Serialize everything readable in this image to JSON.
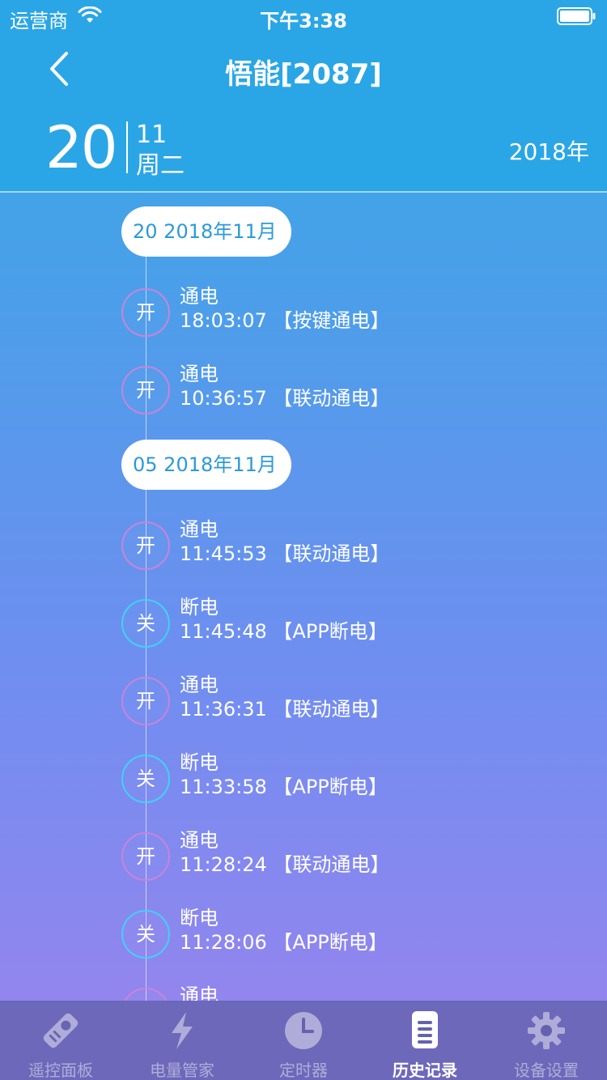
{
  "status_bar": {
    "carrier": "运营商",
    "time": "下午3:38"
  },
  "nav": {
    "title": "悟能[2087]"
  },
  "date_header": {
    "day": "20",
    "month": "11",
    "weekday": "周二",
    "year": "2018年"
  },
  "groups": [
    {
      "date_label": "20  2018年11月",
      "entries": [
        {
          "badge": "开",
          "state": "on",
          "type": "通电",
          "detail": "18:03:07 【按键通电】"
        },
        {
          "badge": "开",
          "state": "on",
          "type": "通电",
          "detail": "10:36:57 【联动通电】"
        }
      ]
    },
    {
      "date_label": "05  2018年11月",
      "entries": [
        {
          "badge": "开",
          "state": "on",
          "type": "通电",
          "detail": "11:45:53 【联动通电】"
        },
        {
          "badge": "关",
          "state": "off",
          "type": "断电",
          "detail": "11:45:48 【APP断电】"
        },
        {
          "badge": "开",
          "state": "on",
          "type": "通电",
          "detail": "11:36:31 【联动通电】"
        },
        {
          "badge": "关",
          "state": "off",
          "type": "断电",
          "detail": "11:33:58 【APP断电】"
        },
        {
          "badge": "开",
          "state": "on",
          "type": "通电",
          "detail": "11:28:24 【联动通电】"
        },
        {
          "badge": "关",
          "state": "off",
          "type": "断电",
          "detail": "11:28:06 【APP断电】"
        },
        {
          "badge": "开",
          "state": "on",
          "type": "通电",
          "detail": ""
        }
      ]
    }
  ],
  "tabs": [
    {
      "label": "遥控面板",
      "icon": "remote-icon",
      "active": false
    },
    {
      "label": "电量管家",
      "icon": "lightning-icon",
      "active": false
    },
    {
      "label": "定时器",
      "icon": "clock-icon",
      "active": false
    },
    {
      "label": "历史记录",
      "icon": "document-icon",
      "active": true
    },
    {
      "label": "设备设置",
      "icon": "gear-icon",
      "active": false
    }
  ],
  "colors": {
    "header_blue": "#2aa6e6",
    "badge_on": "#c984d8",
    "badge_off": "#40d2f5",
    "pill_text": "#2b9ad8"
  }
}
